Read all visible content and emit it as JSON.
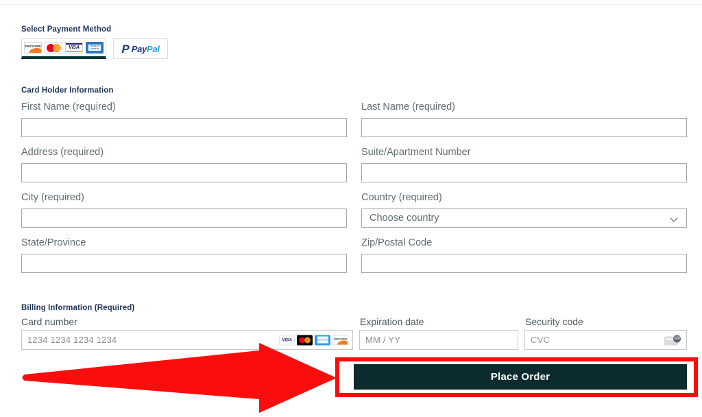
{
  "payment_section": {
    "heading": "Select Payment Method",
    "methods": [
      {
        "id": "credit-cards",
        "selected": true,
        "brands": [
          "Discover",
          "Mastercard",
          "VISA",
          "AMERICAN EXPRESS"
        ]
      },
      {
        "id": "paypal",
        "selected": false,
        "label_pay": "Pay",
        "label_pal": "Pal",
        "mark": "P"
      }
    ]
  },
  "card_holder_section": {
    "heading": "Card Holder Information",
    "fields": [
      {
        "name": "first_name",
        "label": "First Name (required)",
        "value": "",
        "type": "text"
      },
      {
        "name": "last_name",
        "label": "Last Name (required)",
        "value": "",
        "type": "text"
      },
      {
        "name": "address",
        "label": "Address (required)",
        "value": "",
        "type": "text"
      },
      {
        "name": "suite",
        "label": "Suite/Apartment Number",
        "value": "",
        "type": "text"
      },
      {
        "name": "city",
        "label": "City (required)",
        "value": "",
        "type": "text"
      },
      {
        "name": "country",
        "label": "Country (required)",
        "value": "Choose country",
        "type": "select"
      },
      {
        "name": "state",
        "label": "State/Province",
        "value": "",
        "type": "text"
      },
      {
        "name": "zip",
        "label": "Zip/Postal Code",
        "value": "",
        "type": "text"
      }
    ]
  },
  "billing_section": {
    "heading": "Billing Information (Required)",
    "card_number": {
      "label": "Card number",
      "placeholder": "1234 1234 1234 1234",
      "value": "",
      "accepted_brands": [
        "VISA",
        "Mastercard",
        "American Express",
        "Discover"
      ]
    },
    "expiration": {
      "label": "Expiration date",
      "placeholder": "MM / YY",
      "value": ""
    },
    "security": {
      "label": "Security code",
      "placeholder": "CVC",
      "value": "",
      "icon_badge": "123"
    }
  },
  "actions": {
    "place_order_label": "Place Order"
  },
  "annotation": {
    "arrow_color": "#fc0d0d",
    "highlight_color": "#fc0d0d",
    "arrow_direction": "right",
    "points_to": "Place Order"
  },
  "colors": {
    "heading": "#1d3557",
    "label": "#5f6b71",
    "button_bg": "#0b2b2e",
    "tab_selected_underline": "#0d3434"
  }
}
